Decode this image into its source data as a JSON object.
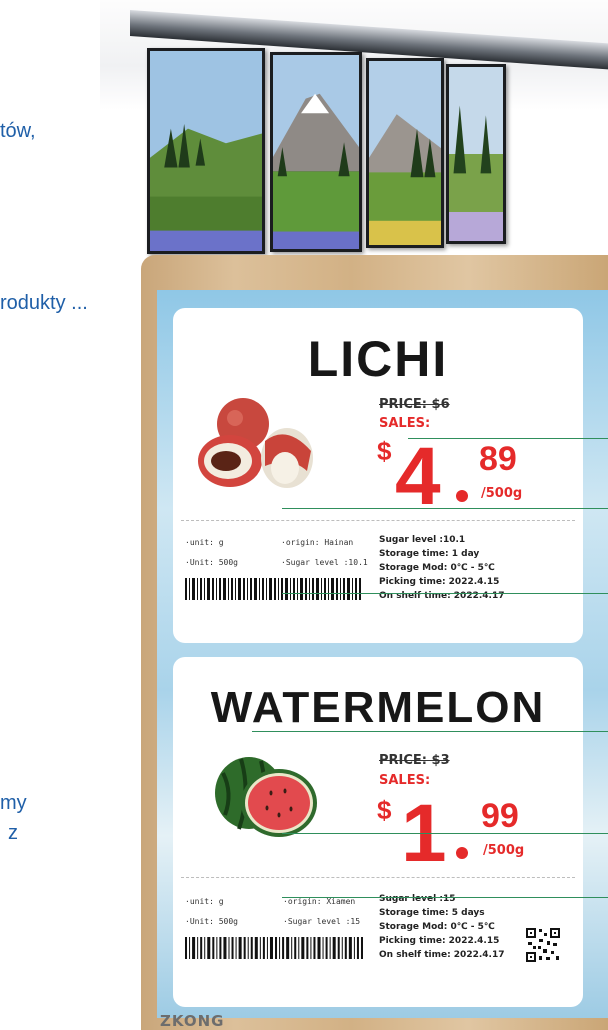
{
  "left_text": [
    "tów,",
    "rodukty ...",
    "my",
    "z"
  ],
  "cards": [
    {
      "title": "LICHI",
      "old_price": "PRICE: $6",
      "sales_label": "SALES:",
      "currency": "$",
      "price_int": "4",
      "price_cents": "89",
      "price_unit": "/500g",
      "unit_g": "·unit: g",
      "unit_weight": "·Unit: 500g",
      "origin": "·origin: Hainan",
      "sugar_small": "·Sugar level :10.1",
      "info": [
        "Sugar level :10.1",
        "Storage time: 1 day",
        "Storage Mod: 0℃ - 5℃",
        "Picking time:  2022.4.15",
        "On shelf time: 2022.4.17"
      ]
    },
    {
      "title": "WATERMELON",
      "old_price": "PRICE: $3",
      "sales_label": "SALES:",
      "currency": "$",
      "price_int": "1",
      "price_cents": "99",
      "price_unit": "/500g",
      "unit_g": "·unit: g",
      "unit_weight": "·Unit: 500g",
      "origin": "·origin: Xiamen",
      "sugar_small": "·Sugar level :15",
      "info": [
        "Sugar level :15",
        "Storage time: 5 days",
        "Storage Mod: 0℃ - 5℃",
        "Picking time:  2022.4.15",
        "On shelf time: 2022.4.17"
      ]
    }
  ],
  "brand": "ZKONG",
  "colors": {
    "price_red": "#e52a2a",
    "annotation_green": "#2f8f5c",
    "left_text_blue": "#1f5fa8"
  },
  "icons": [
    "lychee-illustration",
    "watermelon-illustration",
    "barcode",
    "qr-code",
    "landscape-screen"
  ]
}
